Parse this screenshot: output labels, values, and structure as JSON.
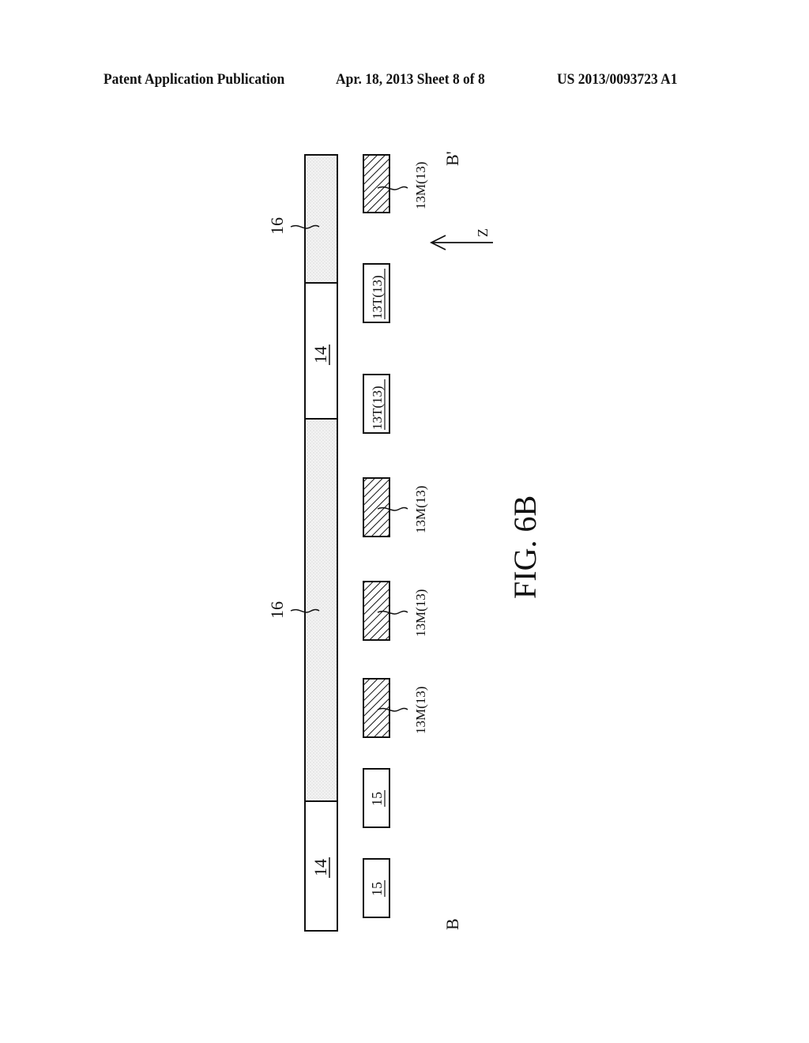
{
  "header": {
    "publication": "Patent Application Publication",
    "date_sheet": "Apr. 18, 2013  Sheet 8 of 8",
    "patent_number": "US 2013/0093723 A1"
  },
  "figure": {
    "caption": "FIG. 6B",
    "section_start": "B",
    "section_end": "B'",
    "axis_label": "Z",
    "top_layer": {
      "segments": [
        {
          "ref": "16",
          "type": "dotted",
          "labeled": true
        },
        {
          "ref": "14",
          "type": "plain",
          "labeled": true
        },
        {
          "ref": "16",
          "type": "dotted",
          "labeled": true
        },
        {
          "ref": "14",
          "type": "plain",
          "labeled": true
        }
      ]
    },
    "lower_blocks": [
      {
        "label": "13M(13)",
        "type": "hatched"
      },
      {
        "label": "13T(13)",
        "type": "outlined"
      },
      {
        "label": "13T(13)",
        "type": "outlined"
      },
      {
        "label": "13M(13)",
        "type": "hatched"
      },
      {
        "label": "13M(13)",
        "type": "hatched"
      },
      {
        "label": "13M(13)",
        "type": "hatched"
      },
      {
        "label": "15",
        "type": "outlined"
      },
      {
        "label": "15",
        "type": "outlined"
      }
    ]
  }
}
